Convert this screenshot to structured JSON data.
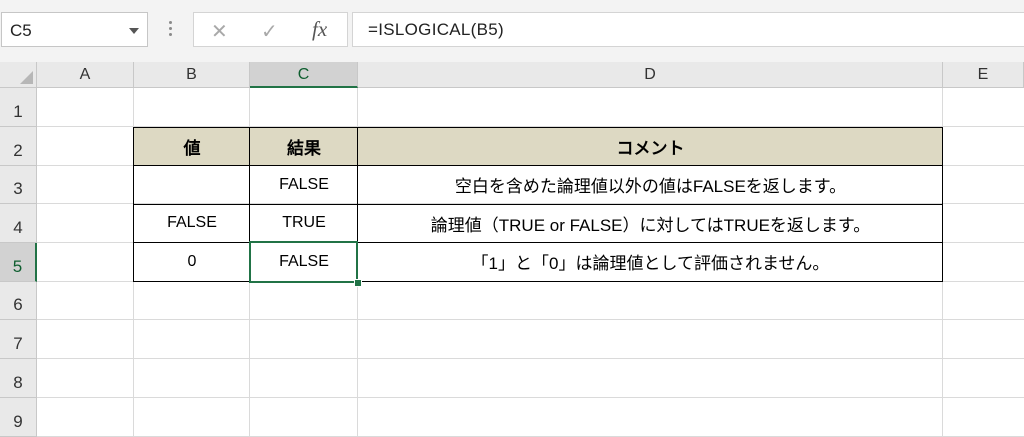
{
  "formula_bar": {
    "name_box": "C5",
    "cancel_icon": "✕",
    "enter_icon": "✓",
    "fx_label": "fx",
    "formula": "=ISLOGICAL(B5)"
  },
  "columns": [
    "A",
    "B",
    "C",
    "D",
    "E"
  ],
  "rows": [
    "1",
    "2",
    "3",
    "4",
    "5",
    "6",
    "7",
    "8",
    "9"
  ],
  "selected_cell": "C5",
  "table": {
    "header": {
      "value": "値",
      "result": "結果",
      "comment": "コメント"
    },
    "header_fill": "#ddd9c3",
    "rows": [
      {
        "value": "",
        "result": "FALSE",
        "comment": "空白を含めた論理値以外の値はFALSEを返します。"
      },
      {
        "value": "FALSE",
        "result": "TRUE",
        "comment": "論理値（TRUE or FALSE）に対してはTRUEを返します。"
      },
      {
        "value": "0",
        "result": "FALSE",
        "comment": "「1」と「0」は論理値として評価されません。"
      }
    ]
  },
  "colors": {
    "accent": "#217346",
    "header_bg": "#e9e9e9",
    "header_selected_bg": "#d2d2d2"
  }
}
